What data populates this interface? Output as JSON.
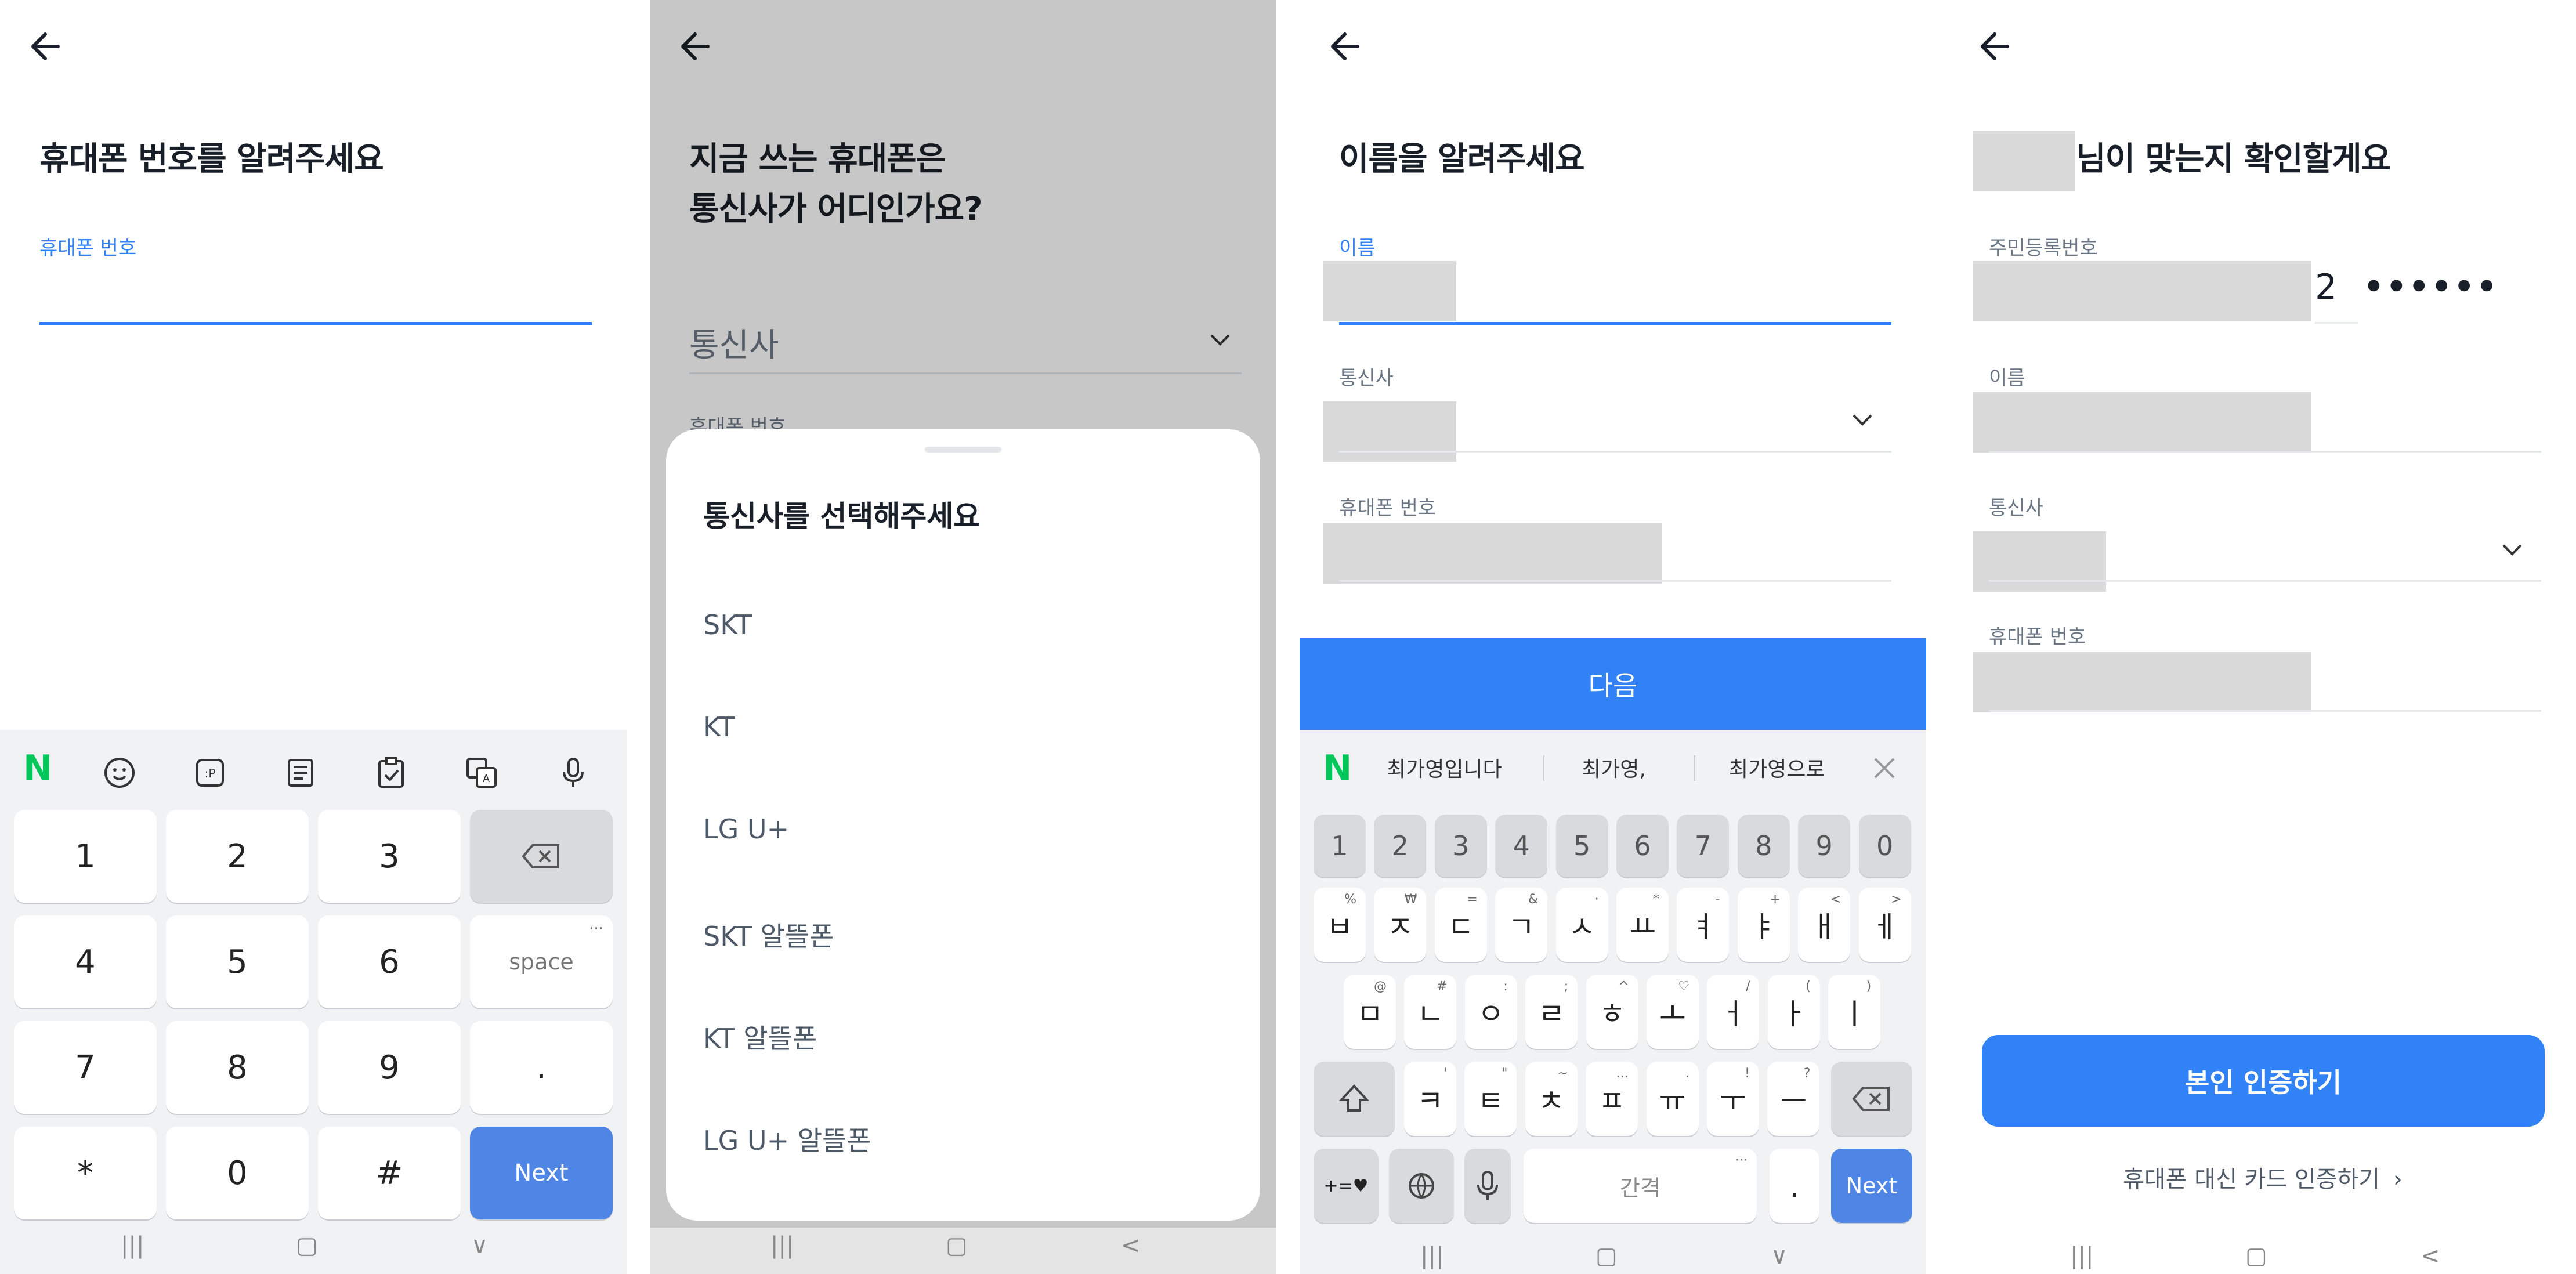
{
  "panel1": {
    "title": "휴대폰 번호를 알려주세요",
    "phone_label": "휴대폰 번호",
    "keyboard": {
      "rows": [
        [
          "1",
          "2",
          "3"
        ],
        [
          "4",
          "5",
          "6"
        ],
        [
          "7",
          "8",
          "9"
        ],
        [
          "*",
          "0",
          "#"
        ]
      ],
      "space": "space",
      "dot": ".",
      "next": "Next"
    }
  },
  "panel2": {
    "title_line1": "지금 쓰는 휴대폰은",
    "title_line2": "통신사가 어디인가요?",
    "carrier_placeholder": "통신사",
    "phone_label_partial": "휴대폰 번호",
    "sheet": {
      "title": "통신사를 선택해주세요",
      "options": [
        "SKT",
        "KT",
        "LG U+",
        "SKT 알뜰폰",
        "KT 알뜰폰",
        "LG U+ 알뜰폰"
      ]
    }
  },
  "panel3": {
    "title": "이름을 알려주세요",
    "name_label": "이름",
    "carrier_label": "통신사",
    "phone_label": "휴대폰 번호",
    "next_button": "다음",
    "suggestions": [
      "최가영입니다",
      "최가영,",
      "최가영으로"
    ],
    "keyboard": {
      "numbers": [
        "1",
        "2",
        "3",
        "4",
        "5",
        "6",
        "7",
        "8",
        "9",
        "0"
      ],
      "row1": [
        [
          "ㅂ",
          "%"
        ],
        [
          "ㅈ",
          "₩"
        ],
        [
          "ㄷ",
          "="
        ],
        [
          "ㄱ",
          "&"
        ],
        [
          "ㅅ",
          "·"
        ],
        [
          "ㅛ",
          "*"
        ],
        [
          "ㅕ",
          "-"
        ],
        [
          "ㅑ",
          "+"
        ],
        [
          "ㅐ",
          "<"
        ],
        [
          "ㅔ",
          ">"
        ]
      ],
      "row2": [
        [
          "ㅁ",
          "@"
        ],
        [
          "ㄴ",
          "#"
        ],
        [
          "ㅇ",
          ":"
        ],
        [
          "ㄹ",
          ";"
        ],
        [
          "ㅎ",
          "^"
        ],
        [
          "ㅗ",
          "♡"
        ],
        [
          "ㅓ",
          "/"
        ],
        [
          "ㅏ",
          "("
        ],
        [
          "ㅣ",
          ")"
        ]
      ],
      "row3": [
        [
          "ㅋ",
          "'"
        ],
        [
          "ㅌ",
          "\""
        ],
        [
          "ㅊ",
          "~"
        ],
        [
          "ㅍ",
          "…"
        ],
        [
          "ㅠ",
          "."
        ],
        [
          "ㅜ",
          "!"
        ],
        [
          "ㅡ",
          "?"
        ]
      ],
      "symbols_key": "+=♥",
      "space": "간격",
      "dot": ".",
      "next": "Next"
    }
  },
  "panel4": {
    "title_suffix": "님이 맞는지 확인할게요",
    "rrn_label": "주민등록번호",
    "rrn_digit": "2",
    "rrn_mask": "● ● ● ● ● ●",
    "name_label": "이름",
    "carrier_label": "통신사",
    "phone_label": "휴대폰 번호",
    "verify_button": "본인 인증하기",
    "card_link": "휴대폰 대신 카드 인증하기"
  },
  "colors": {
    "primary": "#3182f6",
    "keyboard_blue": "#4f86e6",
    "naver_green": "#03c75a",
    "mask_gray": "#d9d9d9",
    "text": "#191f28",
    "sub_text": "#6b7684"
  }
}
